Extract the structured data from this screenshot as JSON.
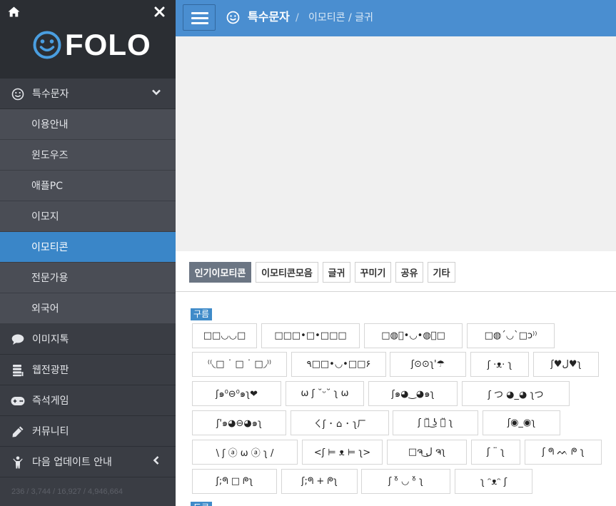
{
  "brand": {
    "logo_text": "FOLO"
  },
  "nav": {
    "items": [
      {
        "label": "특수문자"
      },
      {
        "label": "이미지톡"
      },
      {
        "label": "웹전광판"
      },
      {
        "label": "즉석게임"
      },
      {
        "label": "커뮤니티"
      },
      {
        "label": "다음 업데이트 안내"
      }
    ],
    "sub_items": [
      {
        "label": "이용안내"
      },
      {
        "label": "윈도우즈"
      },
      {
        "label": "애플PC"
      },
      {
        "label": "이모지"
      },
      {
        "label": "이모티콘"
      },
      {
        "label": "전문가용"
      },
      {
        "label": "외국어"
      }
    ],
    "stats_text": "236 / 3,744 / 16,927 / 4,946,664"
  },
  "header": {
    "title": "특수문자",
    "separator": "/",
    "breadcrumb_current": "이모티콘 / 글귀"
  },
  "tabs": [
    {
      "label": "인기이모티콘"
    },
    {
      "label": "이모티콘모음"
    },
    {
      "label": "글귀"
    },
    {
      "label": "꾸미기"
    },
    {
      "label": "공유"
    },
    {
      "label": "기타"
    }
  ],
  "sections": [
    {
      "label": "구름"
    },
    {
      "label": "도르"
    }
  ],
  "emoticons": [
    "□□◡◡□",
    "□□□•□•□□□",
    "□◍ृ•◡•◍ृ□",
    "□◍´◡`□ɔ⁾⁾",
    "⁽⁽◟□ ˙ □ ˙ □◞⁾⁾",
    "٩□□•◡•□□۶",
    "ʃ⊙⊙ʅ'☂",
    "ʃ ·ᴥ· ʅ",
    "ʃ♥ل♥ʅ",
    "ʃ๑⁰⊖⁰๑ʅ❤",
    "ω ʃ ˘ᵕ˘ ʅ ω",
    "ʃ๑◕‿◕๑ʅ",
    "ʃ つ ◕_◕ ʅつ",
    "ʃ'๑◕⊖◕๑ʅ",
    "ㄑʃ ･ ⌂ ･ ʅㄏ",
    "ʃ ･̆ ͜ʖ ･̆ ʅ",
    "ʃ◉_◉ʅ",
    "\\ ʃ ⓐ ω ⓐ ʅ /",
    "<ʃ ⊨ ᴥ ⊨ ʅ>",
    "□ຈ ل͜ ຈʅ",
    "ʃ ¨ ʅ",
    "ʃ ᖗ ᨓ ᖘ ʅ",
    "ʃ;ᖗ □ ᖘʅ",
    "ʃ;ᖗ + ᖘʅ",
    "ʃ ᵒ̌ ◡ ᵒ̌ ʅ",
    "ʅ ᵔᴥᵔ ʃ"
  ],
  "colors": {
    "topbar": "#4a8ed0",
    "sidebar": "#3a3d44",
    "active_item": "#3a86c8",
    "section_label": "#3f8bc9"
  }
}
